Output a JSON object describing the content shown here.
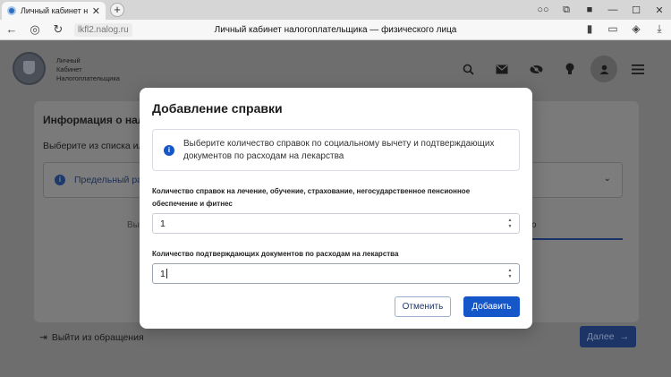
{
  "browser": {
    "tab_title": "Личный кабинет налог",
    "tab_close": "✕",
    "new_tab": "+",
    "url": "lkfl2.nalog.ru",
    "page_title": "Личный кабинет налогоплательщика — физического лица",
    "window_controls": [
      "○○",
      "⧉",
      "■",
      "—",
      "☐",
      "✕"
    ]
  },
  "site": {
    "brand_lines": [
      "Личный",
      "Кабинет",
      "Налогоплательщика"
    ],
    "header_icons": [
      "search-icon",
      "mail-icon",
      "eye-off-icon",
      "bulb-icon",
      "user-icon",
      "menu-icon"
    ]
  },
  "background": {
    "card_title": "Информация о нал",
    "card_subtitle": "Выберите из списка или",
    "card_box_text": "Предельный раз",
    "card_tab_left": "Вы",
    "card_tab_right": "о",
    "exit_link": "Выйти из обращения",
    "next_button": "Далее"
  },
  "modal": {
    "title": "Добавление справки",
    "info_text": "Выберите количество справок по социальному вычету и подтверждающих документов по расходам на лекарства",
    "field1_label": "Количество справок на лечение, обучение, страхование, негосударственное пенсионное обеспечение и фитнес",
    "field1_value": "1",
    "field2_label": "Количество подтверждающих документов по расходам на лекарства",
    "field2_value": "1",
    "cancel_label": "Отменить",
    "add_label": "Добавить"
  },
  "colors": {
    "primary": "#1557c9",
    "overlay_page": "#6e6e6e"
  }
}
